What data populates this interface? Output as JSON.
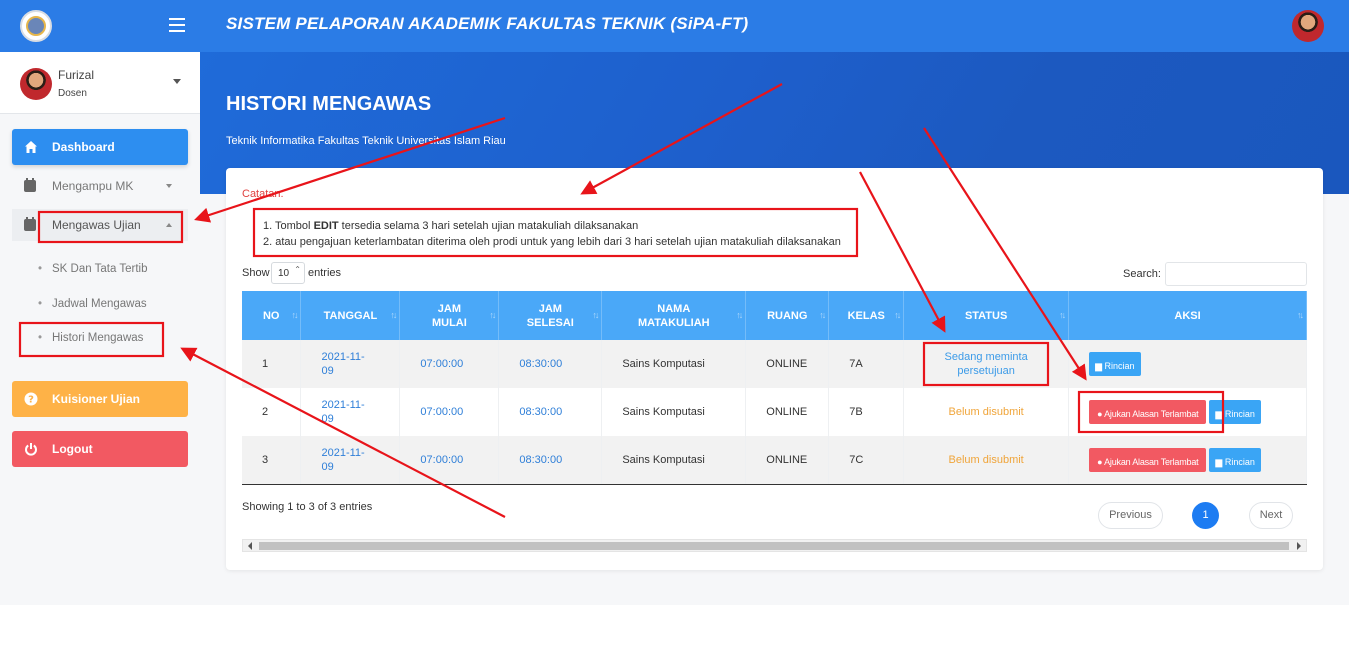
{
  "app": {
    "title": "SISTEM PELAPORAN AKADEMIK FAKULTAS TEKNIK (SiPA-FT)"
  },
  "user": {
    "name": "Furizal",
    "role": "Dosen"
  },
  "sidebar": {
    "dashboard": "Dashboard",
    "mengampu": "Mengampu MK",
    "mengawas": "Mengawas Ujian",
    "sub": [
      "SK Dan Tata Tertib",
      "Jadwal Mengawas",
      "Histori Mengawas"
    ],
    "kuisioner": "Kuisioner Ujian",
    "logout": "Logout"
  },
  "page": {
    "title": "HISTORI MENGAWAS",
    "subtitle": "Teknik Informatika Fakultas Teknik Universitas Islam Riau"
  },
  "notes": {
    "label": "Catatan:",
    "line1_pre": "1. Tombol ",
    "line1_bold": "EDIT",
    "line1_post": " tersedia selama 3 hari setelah ujian matakuliah dilaksanakan",
    "line2": "2. atau pengajuan keterlambatan diterima oleh prodi untuk yang lebih dari 3 hari setelah ujian matakuliah dilaksanakan"
  },
  "controls": {
    "show": "Show",
    "entries_value": "10",
    "entries": "entries",
    "search": "Search:"
  },
  "table": {
    "headers": [
      "NO",
      "TANGGAL",
      "JAM MULAI",
      "JAM SELESAI",
      "NAMA MATAKULIAH",
      "RUANG",
      "KELAS",
      "STATUS",
      "AKSI"
    ],
    "rows": [
      {
        "no": "1",
        "tanggal_a": "2021-11-",
        "tanggal_b": "09",
        "mulai": "07:00:00",
        "selesai": "08:30:00",
        "mk": "Sains Komputasi",
        "ruang": "ONLINE",
        "kelas": "7A",
        "status_a": "Sedang meminta",
        "status_b": "persetujuan",
        "rinci": "Rincian"
      },
      {
        "no": "2",
        "tanggal_a": "2021-11-",
        "tanggal_b": "09",
        "mulai": "07:00:00",
        "selesai": "08:30:00",
        "mk": "Sains Komputasi",
        "ruang": "ONLINE",
        "kelas": "7B",
        "status": "Belum disubmit",
        "ajukan": "Ajukan Alasan Terlambat",
        "rinci": "Rincian"
      },
      {
        "no": "3",
        "tanggal_a": "2021-11-",
        "tanggal_b": "09",
        "mulai": "07:00:00",
        "selesai": "08:30:00",
        "mk": "Sains Komputasi",
        "ruang": "ONLINE",
        "kelas": "7C",
        "status": "Belum disubmit",
        "ajukan": "Ajukan Alasan Terlambat",
        "rinci": "Rincian"
      }
    ]
  },
  "footer": {
    "showing": "Showing 1 to 3 of 3 entries",
    "prev": "Previous",
    "page": "1",
    "next": "Next"
  },
  "colors": {
    "primary": "#2b7ce6",
    "table_head": "#4aa8f8",
    "danger": "#f25962",
    "warning": "#feb247",
    "annotation": "#e8141a"
  }
}
